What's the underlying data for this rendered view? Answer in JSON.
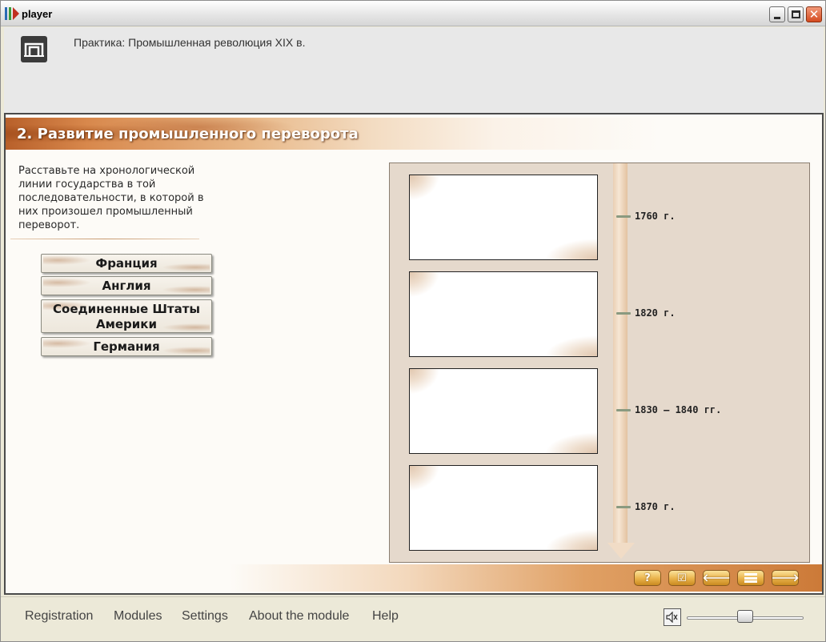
{
  "window": {
    "title": "player",
    "controls": {
      "minimize": "minimize",
      "maximize": "maximize",
      "close": "close"
    }
  },
  "header": {
    "title": "Практика: Промышленная революция XIX в."
  },
  "section": {
    "title": "2. Развитие промышленного переворота"
  },
  "task": {
    "instructions": "Расставьте на хронологической линии государства в той последовательности, в которой в них произошел промышленный переворот."
  },
  "countries": [
    {
      "label": "Франция"
    },
    {
      "label": "Англия"
    },
    {
      "label": "Соединенные Штаты Америки"
    },
    {
      "label": "Германия"
    }
  ],
  "timeline": {
    "dates": [
      "1760 г.",
      "1820 г.",
      "1830 – 1840 гг.",
      "1870 г."
    ],
    "slots_filled": 0
  },
  "navigation": {
    "buttons": [
      {
        "label": "?",
        "icon": "help-icon"
      },
      {
        "label": "☑",
        "icon": "check-icon"
      },
      {
        "label": "🡐",
        "icon": "arrow-left-icon"
      },
      {
        "label": "",
        "icon": "list-icon"
      },
      {
        "label": "🡒",
        "icon": "arrow-right-icon"
      }
    ]
  },
  "footer": {
    "menu": [
      "Registration",
      "Modules",
      "Settings",
      "About the module",
      "Help"
    ],
    "speaker_icon": "speaker-icon",
    "volume": 0.5
  },
  "colors": {
    "accent": "#cc7a38",
    "banner_dark": "#b8602a",
    "panel": "#e5d9cc"
  }
}
